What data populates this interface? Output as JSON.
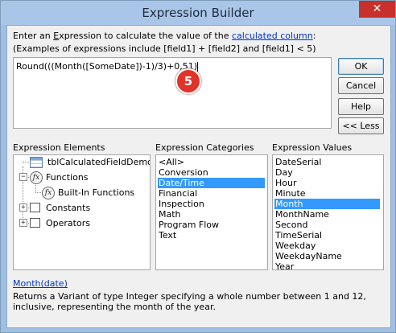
{
  "window": {
    "title": "Expression Builder",
    "close_glyph": "✕"
  },
  "instructions": {
    "prefix": "Enter an ",
    "underlined": "E",
    "rest": "xpression to calculate the value of the ",
    "link": "calculated column",
    "suffix": ":",
    "examples": "(Examples of expressions include [field1] + [field2] and [field1] < 5)"
  },
  "expression": {
    "value": "Round(((Month([SomeDate])-1)/3)+0,51)"
  },
  "callout": {
    "number": "5"
  },
  "buttons": {
    "ok": "OK",
    "cancel": "Cancel",
    "help": "Help",
    "less": "<< Less"
  },
  "elements": {
    "header": "Expression Elements",
    "items": [
      {
        "label": "tblCalculatedFieldDemo",
        "icon": "table-icon"
      },
      {
        "label": "Functions",
        "icon": "function-icon",
        "expanded": true
      },
      {
        "label": "Built-In Functions",
        "icon": "function-icon",
        "selected": true
      },
      {
        "label": "Constants",
        "icon": "folder-icon"
      },
      {
        "label": "Operators",
        "icon": "folder-icon"
      }
    ]
  },
  "categories": {
    "header": "Expression Categories",
    "items": [
      "<All>",
      "Conversion",
      "Date/Time",
      "Financial",
      "Inspection",
      "Math",
      "Program Flow",
      "Text"
    ],
    "selected": "Date/Time"
  },
  "values": {
    "header": "Expression Values",
    "items": [
      "DateSerial",
      "Day",
      "Hour",
      "Minute",
      "Month",
      "MonthName",
      "Second",
      "TimeSerial",
      "Weekday",
      "WeekdayName",
      "Year"
    ],
    "selected": "Month"
  },
  "help": {
    "syntax_link": "Month(date)",
    "description": "Returns a Variant of type Integer specifying a whole number between 1 and 12, inclusive, representing the month of the year."
  },
  "colors": {
    "selection": "#3399ff",
    "link": "#0033cc",
    "close": "#c7302b",
    "callout": "#e0332a"
  }
}
